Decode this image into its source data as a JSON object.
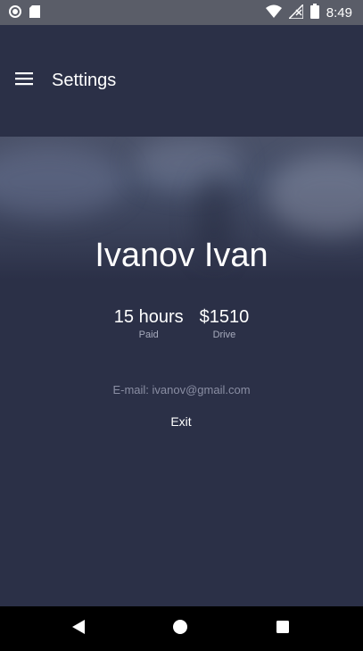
{
  "status_bar": {
    "time": "8:49",
    "icons": [
      "record-icon",
      "sd-card-icon",
      "wifi-icon",
      "no-signal-icon",
      "battery-icon"
    ]
  },
  "app_bar": {
    "title": "Settings",
    "menu_icon": "hamburger-menu-icon"
  },
  "profile": {
    "name": "Ivanov Ivan",
    "stats": [
      {
        "value": "15 hours",
        "label": "Paid"
      },
      {
        "value": "$1510",
        "label": "Drive"
      }
    ],
    "email": "E-mail: ivanov@gmail.com",
    "exit_label": "Exit"
  },
  "nav_bar": {
    "icons": [
      "back-icon",
      "home-icon",
      "recents-icon"
    ]
  },
  "colors": {
    "background": "#2b3047",
    "status_bar": "#5a5d68",
    "nav_bar": "#000000",
    "text_primary": "#ffffff",
    "text_secondary": "#a7abbd",
    "email_text": "#8a8ea3"
  }
}
